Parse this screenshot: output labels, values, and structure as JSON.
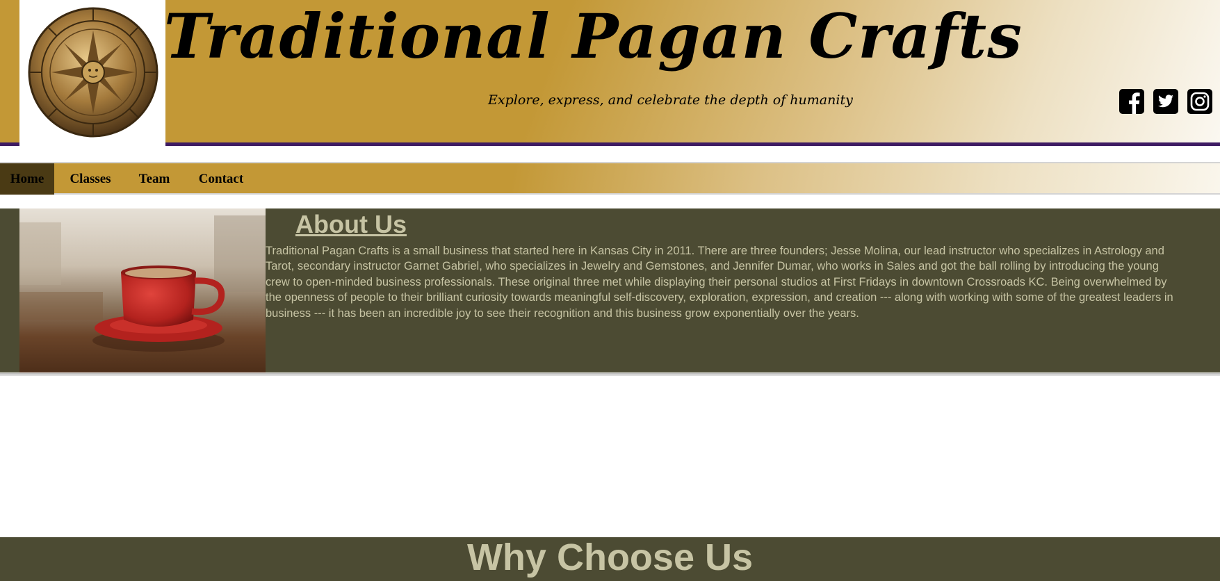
{
  "header": {
    "title": "Traditional Pagan Crafts",
    "tagline": "Explore, express, and celebrate the depth of humanity",
    "logo_icon": "sun-medallion-icon",
    "social": [
      {
        "name": "facebook",
        "icon": "facebook-icon"
      },
      {
        "name": "twitter",
        "icon": "twitter-icon"
      },
      {
        "name": "instagram",
        "icon": "instagram-icon"
      }
    ]
  },
  "nav": {
    "items": [
      {
        "label": "Home",
        "active": true
      },
      {
        "label": "Classes",
        "active": false
      },
      {
        "label": "Team",
        "active": false
      },
      {
        "label": "Contact",
        "active": false
      }
    ]
  },
  "about": {
    "title": "About Us",
    "body": "Traditional Pagan Crafts is a small business that started here in Kansas City in 2011. There are three founders; Jesse Molina, our lead instructor who specializes in Astrology and Tarot, secondary instructor Garnet Gabriel, who specializes in Jewelry and Gemstones, and Jennifer Dumar, who works in Sales and got the ball rolling by introducing the young crew to open-minded business professionals. These original three met while displaying their personal studios at First Fridays in downtown Crossroads KC. Being overwhelmed by the openness of people to their brilliant curiosity towards meaningful self-discovery, exploration, expression, and creation --- along with working with some of the greatest leaders in business --- it has been an incredible joy to see their recognition and this business grow exponentially over the years.",
    "image": "red-coffee-cup-photo"
  },
  "why": {
    "title": "Why Choose Us"
  },
  "colors": {
    "gold": "#c39836",
    "purple_rule": "#3e1b63",
    "olive_bg": "#4c4b33",
    "olive_text": "#c7c4a4",
    "nav_active": "#4a3a14"
  }
}
